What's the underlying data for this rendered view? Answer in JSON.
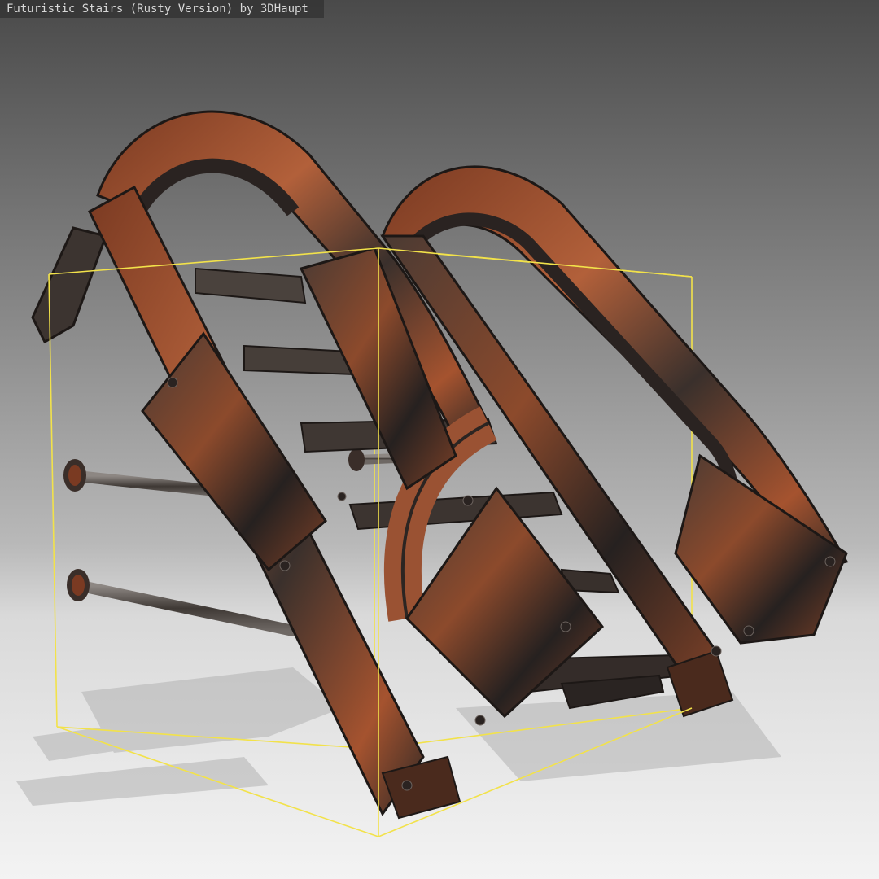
{
  "viewer": {
    "title": "Futuristic Stairs (Rusty Version) by 3DHaupt"
  },
  "scene": {
    "subject": "rusty-stairs-model",
    "colors": {
      "rust": "#a5532f",
      "rust_light": "#c0683e",
      "metal_dark": "#2b2624",
      "metal_mid": "#4d4540",
      "bounding_box": "#f2e24a",
      "floor_shadow": "#b6b6b6"
    }
  }
}
